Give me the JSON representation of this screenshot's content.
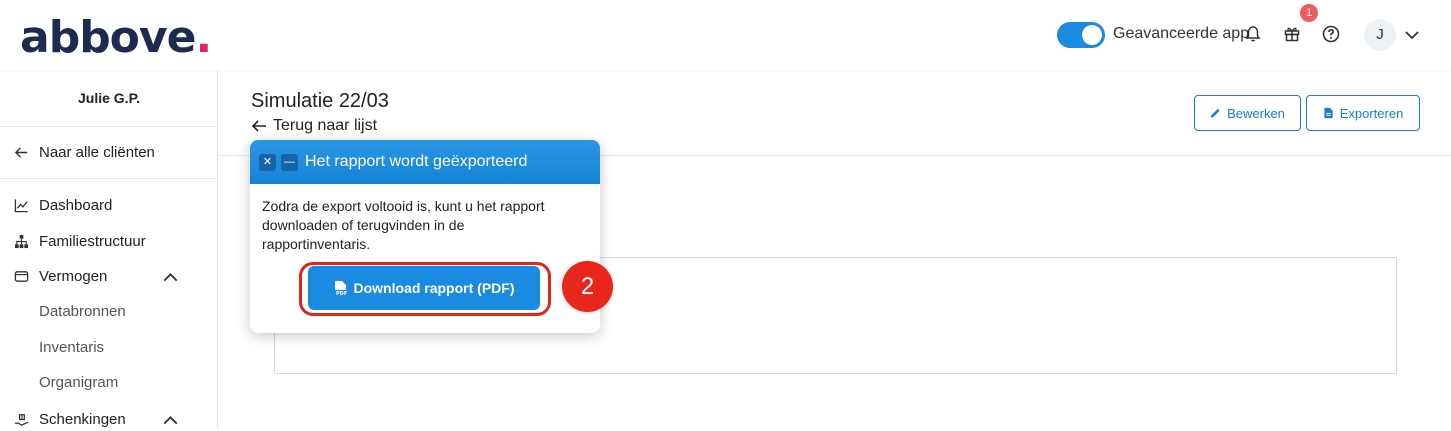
{
  "header": {
    "logo_text": "abbove",
    "logo_dot": ".",
    "advanced_label": "Geavanceerde app",
    "advanced_enabled": true,
    "gift_badge_count": "1",
    "avatar_initial": "J",
    "icons": [
      "bell-icon",
      "gift-icon",
      "help-icon",
      "chevron-down-icon"
    ]
  },
  "sidebar": {
    "user_name": "Julie G.P.",
    "back_label": "Naar alle cliënten",
    "items": [
      {
        "label": "Dashboard",
        "icon": "chart-line-icon"
      },
      {
        "label": "Familiestructuur",
        "icon": "sitemap-icon"
      },
      {
        "label": "Vermogen",
        "icon": "wallet-icon",
        "expanded": true
      },
      {
        "label": "Databronnen",
        "sub": true
      },
      {
        "label": "Inventaris",
        "sub": true
      },
      {
        "label": "Organigram",
        "sub": true
      },
      {
        "label": "Schenkingen",
        "icon": "hand-gift-icon",
        "expanded": true
      }
    ]
  },
  "main": {
    "title": "Simulatie 22/03",
    "back_link": "Terug naar lijst",
    "edit_button": "Bewerken",
    "export_button": "Exporteren"
  },
  "popup": {
    "close_symbol": "✕",
    "minimize_symbol": "—",
    "title": "Het rapport wordt geëxporteerd",
    "message": "Zodra de export voltooid is, kunt u het rapport downloaden of terugvinden in de rapportinventaris.",
    "download_button": "Download rapport (PDF)",
    "step_number": "2"
  },
  "colors": {
    "accent": "#1a8be0",
    "brand_dark": "#1d2b4f",
    "brand_pink": "#e0246a",
    "highlight_red": "#e1251b"
  }
}
